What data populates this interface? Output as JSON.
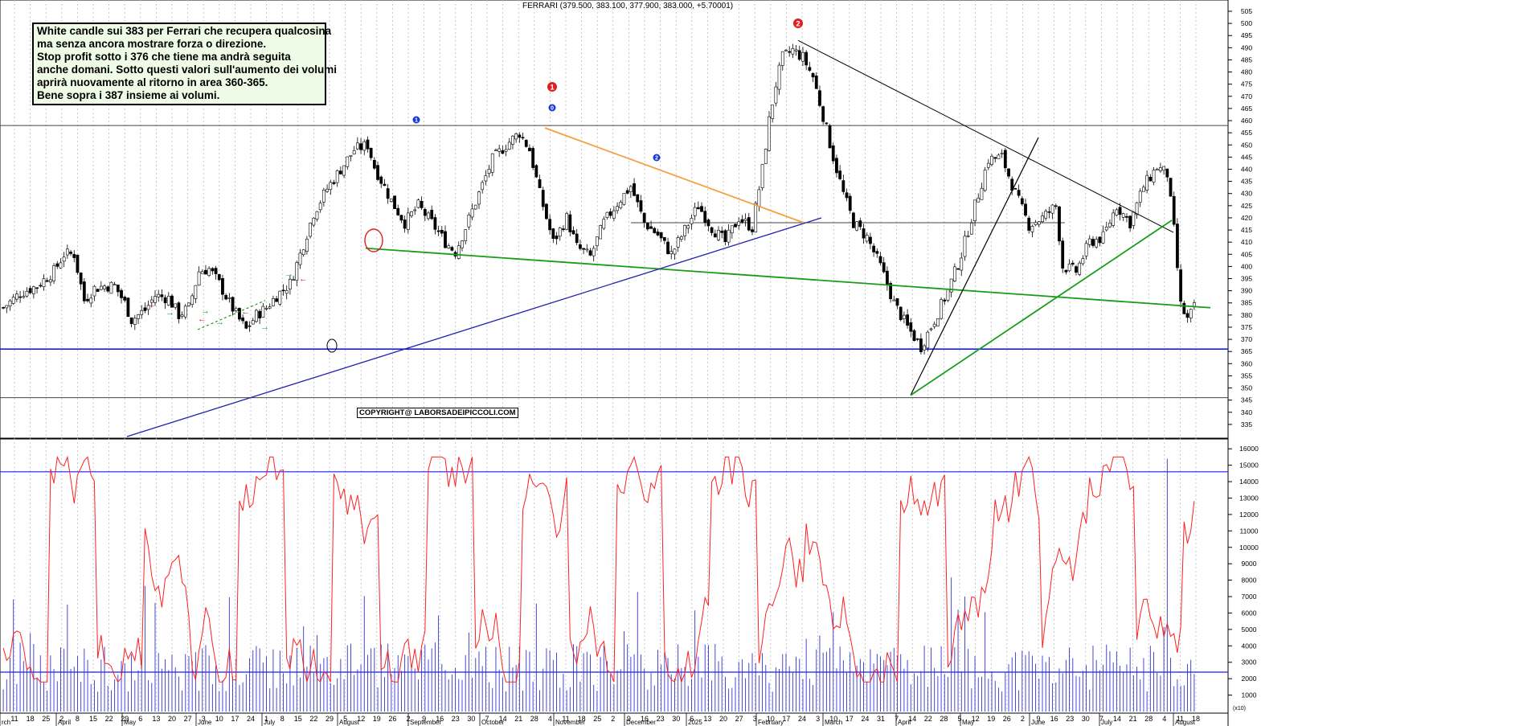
{
  "chart_data": [
    {
      "type": "candlestick",
      "title": "FERRARI (379.500, 383.100, 377.900, 383.000, +5.70001)",
      "ylim": [
        330,
        505
      ],
      "y_ticks": [
        335,
        340,
        345,
        350,
        355,
        360,
        365,
        370,
        375,
        380,
        385,
        390,
        395,
        400,
        405,
        410,
        415,
        420,
        425,
        430,
        435,
        440,
        445,
        450,
        455,
        460,
        465,
        470,
        475,
        480,
        485,
        490,
        495,
        500,
        505
      ],
      "grid": "vertical dotted",
      "x_day_labels": [
        "11",
        "18",
        "25",
        "2",
        "8",
        "15",
        "22",
        "29",
        "6",
        "13",
        "20",
        "27",
        "3",
        "10",
        "17",
        "24",
        "1",
        "8",
        "15",
        "22",
        "29",
        "5",
        "12",
        "19",
        "26",
        "2",
        "9",
        "16",
        "23",
        "30",
        "7",
        "14",
        "21",
        "28",
        "4",
        "11",
        "18",
        "25",
        "2",
        "9",
        "16",
        "23",
        "30",
        "6",
        "13",
        "20",
        "27",
        "3",
        "10",
        "17",
        "24",
        "3",
        "10",
        "17",
        "24",
        "31",
        "7",
        "14",
        "22",
        "28",
        "5",
        "12",
        "19",
        "26",
        "2",
        "9",
        "16",
        "23",
        "30",
        "7",
        "14",
        "21",
        "28",
        "4",
        "11",
        "18"
      ],
      "x_month_labels": [
        "rch",
        "April",
        "May",
        "June",
        "July",
        "August",
        "September",
        "October",
        "November",
        "December",
        "2025",
        "February",
        "March",
        "April",
        "May",
        "June",
        "July",
        "August"
      ],
      "price_path": [
        [
          0,
          383
        ],
        [
          5,
          389
        ],
        [
          10,
          392
        ],
        [
          15,
          398
        ],
        [
          18,
          405
        ],
        [
          21,
          405
        ],
        [
          24,
          386
        ],
        [
          27,
          391
        ],
        [
          30,
          392
        ],
        [
          33,
          392
        ],
        [
          36,
          385
        ],
        [
          38,
          378
        ],
        [
          42,
          382
        ],
        [
          45,
          388
        ],
        [
          49,
          387
        ],
        [
          52,
          380
        ],
        [
          55,
          383
        ],
        [
          58,
          398
        ],
        [
          61,
          399
        ],
        [
          64,
          393
        ],
        [
          67,
          385
        ],
        [
          70,
          378
        ],
        [
          72,
          374
        ],
        [
          75,
          380
        ],
        [
          78,
          383
        ],
        [
          81,
          388
        ],
        [
          85,
          393
        ],
        [
          88,
          405
        ],
        [
          92,
          422
        ],
        [
          96,
          432
        ],
        [
          100,
          440
        ],
        [
          104,
          448
        ],
        [
          108,
          450
        ],
        [
          110,
          441
        ],
        [
          115,
          427
        ],
        [
          119,
          418
        ],
        [
          123,
          425
        ],
        [
          127,
          418
        ],
        [
          131,
          410
        ],
        [
          134,
          406
        ],
        [
          137,
          416
        ],
        [
          141,
          430
        ],
        [
          145,
          444
        ],
        [
          149,
          450
        ],
        [
          153,
          455
        ],
        [
          156,
          448
        ],
        [
          159,
          430
        ],
        [
          163,
          410
        ],
        [
          167,
          420
        ],
        [
          170,
          408
        ],
        [
          174,
          404
        ],
        [
          178,
          418
        ],
        [
          182,
          426
        ],
        [
          186,
          433
        ],
        [
          190,
          418
        ],
        [
          194,
          413
        ],
        [
          198,
          405
        ],
        [
          202,
          415
        ],
        [
          206,
          425
        ],
        [
          210,
          416
        ],
        [
          214,
          410
        ],
        [
          218,
          420
        ],
        [
          222,
          416
        ],
        [
          225,
          440
        ],
        [
          227,
          460
        ],
        [
          229,
          475
        ],
        [
          231,
          486
        ],
        [
          234,
          489
        ],
        [
          237,
          486
        ],
        [
          240,
          478
        ],
        [
          243,
          462
        ],
        [
          246,
          445
        ],
        [
          249,
          430
        ],
        [
          252,
          418
        ],
        [
          256,
          412
        ],
        [
          260,
          400
        ],
        [
          264,
          385
        ],
        [
          268,
          375
        ],
        [
          272,
          367
        ],
        [
          276,
          378
        ],
        [
          280,
          390
        ],
        [
          284,
          405
        ],
        [
          288,
          425
        ],
        [
          292,
          444
        ],
        [
          296,
          445
        ],
        [
          300,
          430
        ],
        [
          304,
          417
        ],
        [
          308,
          420
        ],
        [
          312,
          425
        ],
        [
          314,
          400
        ],
        [
          318,
          398
        ],
        [
          322,
          410
        ],
        [
          326,
          412
        ],
        [
          330,
          425
        ],
        [
          334,
          418
        ],
        [
          338,
          433
        ],
        [
          342,
          441
        ],
        [
          345,
          438
        ],
        [
          347,
          415
        ],
        [
          349,
          384
        ],
        [
          351,
          378
        ],
        [
          353,
          383
        ]
      ],
      "annotations": [
        "1",
        "0",
        "1",
        "2",
        "2"
      ],
      "lines": [
        "green descending support",
        "blue ascending trendline",
        "orange descending resistance",
        "black descending resistance",
        "black steep uptrend",
        "green uptrend",
        "horizontal resistance ~458",
        "horizontal support ~366",
        "horizontal ~346"
      ]
    },
    {
      "type": "bar+line",
      "series": [
        {
          "name": "",
          "values": []
        }
      ],
      "ylim": [
        0,
        16500
      ],
      "y_ticks": [
        1000,
        2000,
        3000,
        4000,
        5000,
        6000,
        7000,
        8000,
        9000,
        10000,
        11000,
        12000,
        13000,
        14000,
        15000,
        16000
      ],
      "ref_lines": [
        14600,
        2400
      ],
      "unit_label": "(x10)"
    }
  ],
  "note": {
    "lines": [
      "White candle sui 383 per Ferrari che recupera qualcosina",
      "ma senza ancora mostrare forza o direzione.",
      "Stop profit sotto i 376 che tiene ma andrà seguita",
      "anche domani. Sotto questi valori sull'aumento dei volumi",
      "aprirà nuovamente al ritorno in area 360-365.",
      "Bene sopra i 387 insieme ai volumi."
    ]
  },
  "copyright": "COPYRIGHT@ LABORSADEIPICCOLI.COM",
  "colors": {
    "up": "#ffffff",
    "down": "#000000",
    "blue_line": "#1a1aff",
    "green_line": "#1a9c1a",
    "orange_line": "#f5a040",
    "osc": "#ff2020",
    "vol": "#3333cc"
  }
}
